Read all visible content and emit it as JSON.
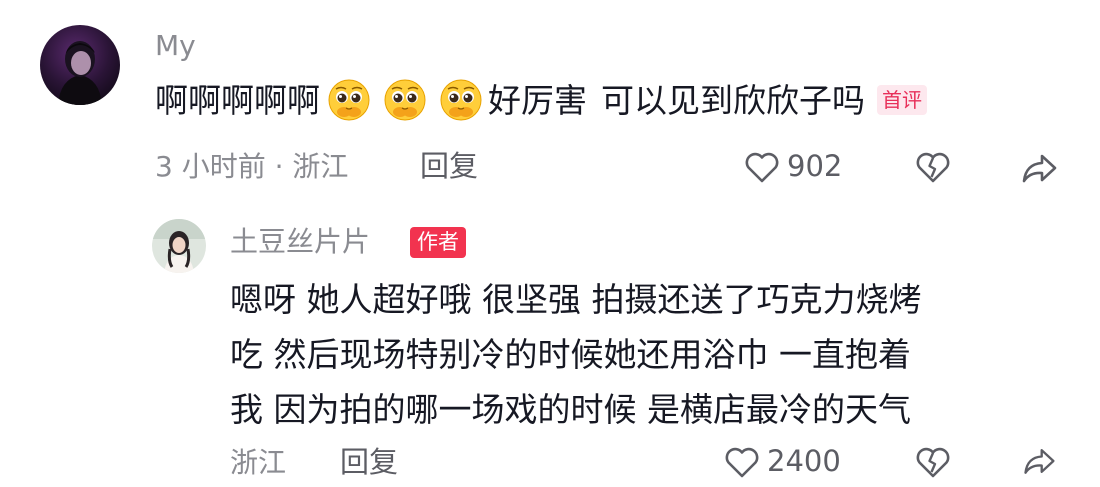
{
  "comment": {
    "username": "My",
    "text_prefix": "啊啊啊啊啊",
    "emojis": [
      "pleading-face-emoji",
      "pleading-face-emoji",
      "pleading-face-emoji"
    ],
    "text_part1": "好厉害",
    "text_part2": "可以见到欣欣子吗",
    "badge": "首评",
    "meta": "3 小时前 · 浙江",
    "reply_label": "回复",
    "like_count": "902"
  },
  "reply": {
    "username": "土豆丝片片",
    "badge": "作者",
    "lines": [
      "嗯呀 她人超好哦 很坚强 拍摄还送了巧克力烧烤",
      "吃 然后现场特别冷的时候她还用浴巾 一直抱着",
      "我 因为拍的哪一场戏的时候 是横店最冷的天气"
    ],
    "meta": "浙江",
    "reply_label": "回复",
    "like_count": "2400"
  },
  "icons": {
    "like": "heart-outline-icon",
    "dislike": "broken-heart-icon",
    "share": "share-arrow-icon"
  },
  "colors": {
    "meta_gray": "#8a8b91",
    "badge_red": "#f2334f",
    "first_badge_bg": "#fde8ee"
  }
}
